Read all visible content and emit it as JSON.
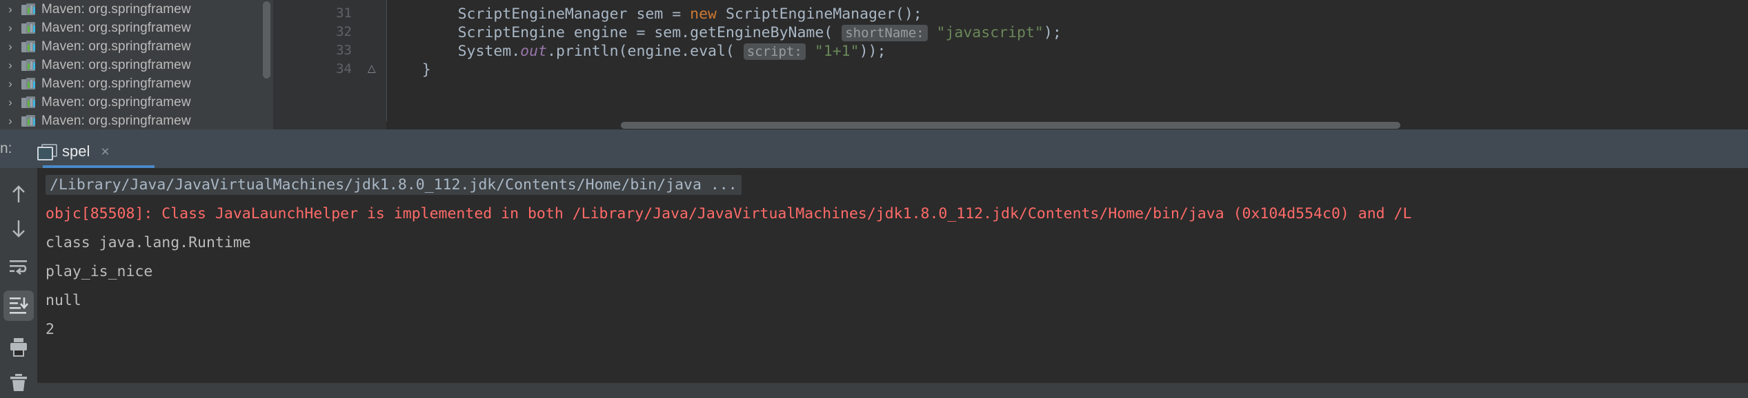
{
  "sidebar": {
    "name": "maven-library-tree",
    "items": [
      {
        "chevron": "›",
        "label": "Maven: org.springframew"
      },
      {
        "chevron": "›",
        "label": "Maven: org.springframew"
      },
      {
        "chevron": "›",
        "label": "Maven: org.springframew"
      },
      {
        "chevron": "›",
        "label": "Maven: org.springframew"
      },
      {
        "chevron": "›",
        "label": "Maven: org.springframew"
      },
      {
        "chevron": "›",
        "label": "Maven: org.springframew"
      },
      {
        "chevron": "›",
        "label": "Maven: org.springframew"
      }
    ]
  },
  "editor": {
    "line_numbers": [
      "31",
      "32",
      "33",
      "34"
    ],
    "fold_icon": "△",
    "lines": {
      "l31": {
        "indent": "        ",
        "type": "ScriptEngineManager",
        "space1": " ",
        "var": "sem",
        "eq": " = ",
        "kw_new": "new",
        "ctor": " ScriptEngineManager();"
      },
      "l32": {
        "indent": "        ",
        "type": "ScriptEngine",
        "var": " engine = sem.getEngineByName( ",
        "hint": "shortName:",
        "str": "\"javascript\"",
        "tail": ");"
      },
      "l33": {
        "indent": "        ",
        "pre": "System.",
        "field": "out",
        "mid": ".println(engine.eval( ",
        "hint": "script:",
        "str": "\"1+1\"",
        "tail": "));"
      },
      "l34": {
        "indent": "    ",
        "text": "}"
      }
    }
  },
  "run_panel": {
    "label_clipped": "n:",
    "tab": {
      "label": "spel",
      "close": "×"
    },
    "toolbar": [
      {
        "name": "rerun-up-arrow-icon",
        "glyph": "↑",
        "active": false
      },
      {
        "name": "rerun-down-arrow-icon",
        "glyph": "↓",
        "active": false
      },
      {
        "name": "soft-wrap-icon",
        "glyph": "",
        "active": false
      },
      {
        "name": "scroll-to-end-icon",
        "glyph": "",
        "active": true
      },
      {
        "name": "print-icon",
        "glyph": "",
        "active": false
      },
      {
        "name": "trash-icon",
        "glyph": "",
        "active": false
      }
    ],
    "console_lines": [
      {
        "text": "/Library/Java/JavaVirtualMachines/jdk1.8.0_112.jdk/Contents/Home/bin/java ...",
        "style": "cmd"
      },
      {
        "text": "objc[85508]: Class JavaLaunchHelper is implemented in both /Library/Java/JavaVirtualMachines/jdk1.8.0_112.jdk/Contents/Home/bin/java (0x104d554c0) and /L",
        "style": "err"
      },
      {
        "text": "class java.lang.Runtime",
        "style": "plain"
      },
      {
        "text": "play_is_nice",
        "style": "plain"
      },
      {
        "text": "null",
        "style": "plain"
      },
      {
        "text": "2",
        "style": "plain"
      }
    ]
  },
  "colors": {
    "accent": "#4a88c7",
    "error": "#ff6b68",
    "keyword": "#cc7832",
    "string": "#6a8759",
    "editor_bg": "#2b2b2b",
    "panel_bg": "#3c3f41"
  }
}
